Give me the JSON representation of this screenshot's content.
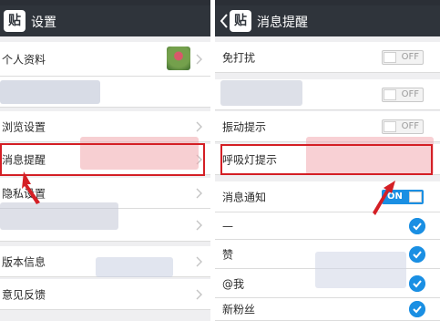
{
  "left": {
    "app_glyph": "贴",
    "title": "设置",
    "items": [
      {
        "label": "个人资料"
      },
      {
        "label": ""
      },
      {
        "label": "浏览设置"
      },
      {
        "label": "消息提醒"
      },
      {
        "label": "隐私设置"
      },
      {
        "label": ""
      },
      {
        "label": "版本信息"
      },
      {
        "label": "意见反馈"
      }
    ]
  },
  "right": {
    "app_glyph": "贴",
    "title": "消息提醒",
    "items": [
      {
        "label": "免打扰",
        "toggle": "OFF"
      },
      {
        "label": "",
        "toggle": "OFF"
      },
      {
        "label": "振动提示",
        "toggle": "OFF"
      },
      {
        "label": "呼吸灯提示"
      },
      {
        "label": "消息通知",
        "toggle": "ON"
      },
      {
        "label": "—",
        "checked": true
      },
      {
        "label": "赞",
        "checked": true
      },
      {
        "label": "@我",
        "checked": true
      },
      {
        "label": "新粉丝",
        "checked": true
      }
    ]
  },
  "colors": {
    "topbar": "#2f343b",
    "accent": "#1a8fe3",
    "highlight": "#d41f25"
  },
  "icons": [
    "app-icon",
    "back-icon",
    "chevron-right-icon",
    "check-icon",
    "toggle-switch",
    "arrow-pointer"
  ]
}
